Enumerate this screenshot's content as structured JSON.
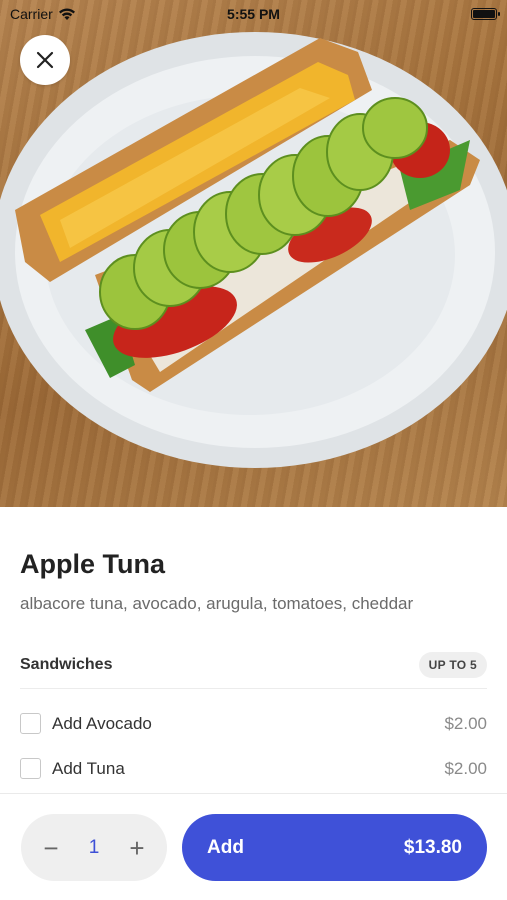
{
  "status_bar": {
    "carrier": "Carrier",
    "time": "5:55 PM"
  },
  "item": {
    "title": "Apple Tuna",
    "description": "albacore tuna, avocado, arugula, tomatoes, cheddar"
  },
  "section": {
    "title": "Sandwiches",
    "limit_badge": "UP TO 5",
    "options": [
      {
        "label": "Add Avocado",
        "price": "$2.00"
      },
      {
        "label": "Add Tuna",
        "price": "$2.00"
      }
    ]
  },
  "cart": {
    "quantity": "1",
    "decrement": "−",
    "increment": "+",
    "add_label": "Add",
    "total": "$13.80"
  },
  "colors": {
    "accent": "#3f51d8",
    "quantity_text": "#3d4fd6"
  }
}
